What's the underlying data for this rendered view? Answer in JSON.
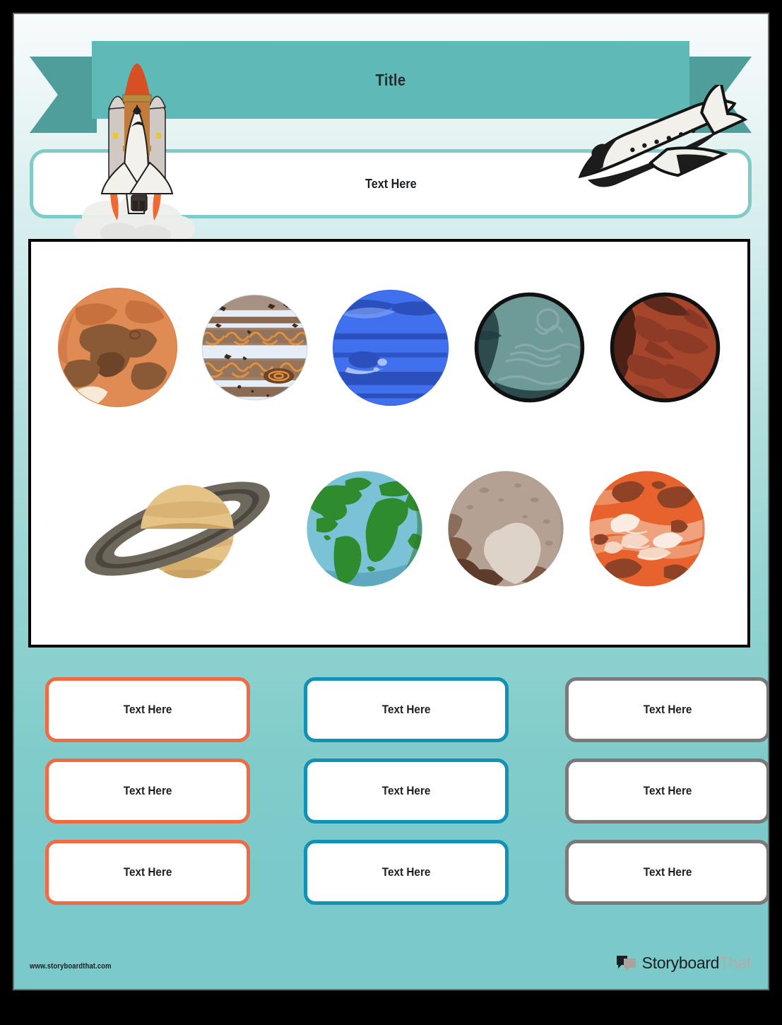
{
  "document": {
    "kind": "worksheet-template",
    "theme_colors": {
      "banner": "#5fbab7",
      "banner_tail": "#4f9e9c",
      "page_bg_top": "#f7fbfc",
      "page_bg_bottom": "#7bc9c9",
      "accent_orange": "#f26a44",
      "accent_blue": "#1191b6",
      "accent_grey": "#7a7a7a",
      "subtitle_border": "#7ecbc8",
      "panel_border": "#000000"
    }
  },
  "header": {
    "title": "Title",
    "subtitle_placeholder": "Text Here",
    "rocket_icon": "rocket-launch-icon",
    "shuttle_icon": "space-shuttle-icon"
  },
  "planet_panel": {
    "rows": [
      {
        "planets": [
          {
            "name": "mars",
            "icon": "planet-mars-icon",
            "size": 175,
            "colors": {
              "base": "#e08a54",
              "feature": "#8a5a37",
              "shade": "#c9703f",
              "cap": "#f7ead9"
            }
          },
          {
            "name": "jupiter",
            "icon": "planet-jupiter-icon",
            "size": 155,
            "colors": {
              "base": "#e3ecf5",
              "band": "#8a6a52",
              "band2": "#a88f7c",
              "swirl": "#e2903f",
              "spot": "#8a5a37"
            }
          },
          {
            "name": "neptune",
            "icon": "planet-neptune-icon",
            "size": 170,
            "colors": {
              "base": "#4170ef",
              "band": "#2b50bd",
              "spot": "#2b50bd",
              "light": "#8fb0f8"
            }
          },
          {
            "name": "uranus",
            "icon": "planet-uranus-icon",
            "size": 163,
            "colors": {
              "base": "#6e9b98",
              "shade": "#2d4a4c",
              "line": "#7e9fa3",
              "outline": "#111111"
            }
          },
          {
            "name": "mercury",
            "icon": "planet-mercury-icon",
            "size": 163,
            "colors": {
              "base": "#a4452c",
              "shade": "#4e2117",
              "streak": "#8d3a26",
              "outline": "#111111"
            }
          }
        ]
      },
      {
        "planets": [
          {
            "name": "saturn",
            "icon": "planet-saturn-icon",
            "size": 200,
            "colors": {
              "base": "#e5c387",
              "band": "#caa364",
              "ring_outer": "#6e675c",
              "ring_inner": "#4b463e"
            }
          },
          {
            "name": "earth",
            "icon": "planet-earth-icon",
            "size": 170,
            "colors": {
              "ocean": "#7bc2d6",
              "land": "#2e8b2e",
              "shade": "#5fa8bd"
            }
          },
          {
            "name": "pluto",
            "icon": "planet-pluto-icon",
            "size": 170,
            "colors": {
              "base": "#b5a194",
              "heart": "#ddd3c9",
              "dark": "#7e5a44",
              "dark2": "#5d3c2b"
            }
          },
          {
            "name": "venus",
            "icon": "planet-venus-icon",
            "size": 170,
            "colors": {
              "base": "#e8622d",
              "light": "#efa27c",
              "lighter": "#f6d7c6",
              "dark": "#8e4327"
            }
          }
        ]
      }
    ]
  },
  "answer_boxes": [
    {
      "id": "box-1",
      "label": "Text Here",
      "accent": "orange"
    },
    {
      "id": "box-2",
      "label": "Text Here",
      "accent": "blue"
    },
    {
      "id": "box-3",
      "label": "Text Here",
      "accent": "grey"
    },
    {
      "id": "box-4",
      "label": "Text Here",
      "accent": "orange"
    },
    {
      "id": "box-5",
      "label": "Text Here",
      "accent": "blue"
    },
    {
      "id": "box-6",
      "label": "Text Here",
      "accent": "grey"
    },
    {
      "id": "box-7",
      "label": "Text Here",
      "accent": "orange"
    },
    {
      "id": "box-8",
      "label": "Text Here",
      "accent": "blue"
    },
    {
      "id": "box-9",
      "label": "Text Here",
      "accent": "grey"
    }
  ],
  "footer": {
    "url": "www.storyboardthat.com",
    "logo_icon": "speech-bubbles-icon",
    "logo_primary": "Storyboard",
    "logo_secondary": "That"
  }
}
